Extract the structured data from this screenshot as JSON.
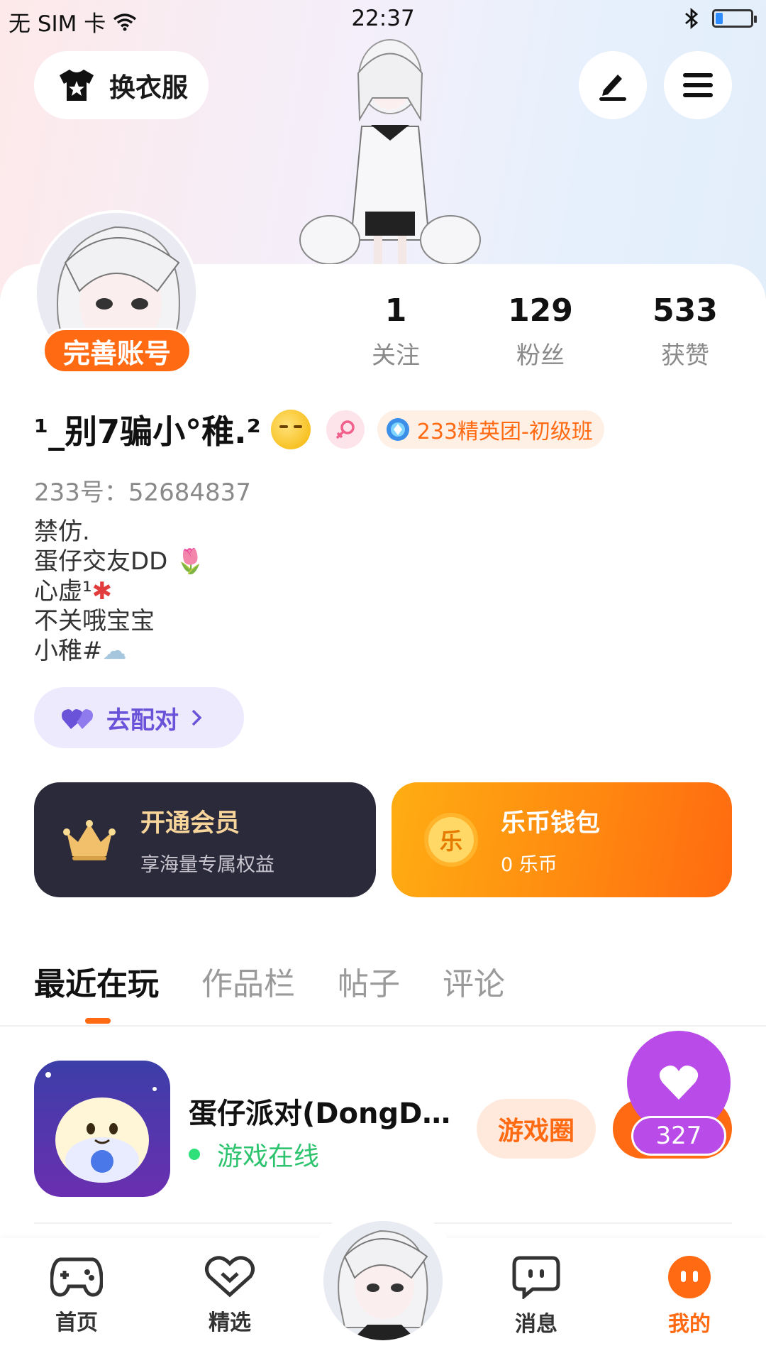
{
  "status_bar": {
    "carrier": "无 SIM 卡",
    "time": "22:37",
    "battery_level": 0.2
  },
  "header": {
    "outfit_label": "换衣服",
    "edit_icon": "pen-icon",
    "menu_icon": "menu-icon"
  },
  "profile": {
    "complete_account_label": "完善账号",
    "username": "¹_别7骗小°稚.²",
    "club_badge": "233精英团-初级班",
    "uid_text": "233号：52684837",
    "bio_lines": [
      "禁仿.",
      "蛋仔交友DD",
      "心虚¹",
      "不关哦宝宝",
      "小稚#"
    ]
  },
  "stats": [
    {
      "value": "1",
      "label": "关注"
    },
    {
      "value": "129",
      "label": "粉丝"
    },
    {
      "value": "533",
      "label": "获赞"
    }
  ],
  "pair": {
    "label": "去配对"
  },
  "vip": {
    "title": "开通会员",
    "subtitle": "享海量专属权益"
  },
  "wallet": {
    "title": "乐币钱包",
    "subtitle": "0 乐币",
    "coin_glyph": "乐"
  },
  "tabs": [
    {
      "label": "最近在玩",
      "active": true
    },
    {
      "label": "作品栏",
      "active": false
    },
    {
      "label": "帖子",
      "active": false
    },
    {
      "label": "评论",
      "active": false
    }
  ],
  "games": [
    {
      "title": "蛋仔派对(DongDo…",
      "status": "游戏在线",
      "circle_button": "游戏圈"
    }
  ],
  "like_float": {
    "count": "327"
  },
  "bottom_nav": [
    {
      "label": "首页",
      "active": false
    },
    {
      "label": "精选",
      "active": false
    },
    {
      "label": "",
      "active": false
    },
    {
      "label": "消息",
      "active": false
    },
    {
      "label": "我的",
      "active": true
    }
  ],
  "colors": {
    "accent": "#ff6a13",
    "vip_bg": "#2b2a3b",
    "online": "#2ec36f",
    "like": "#b94ce8",
    "pair": "#6a52d9"
  }
}
